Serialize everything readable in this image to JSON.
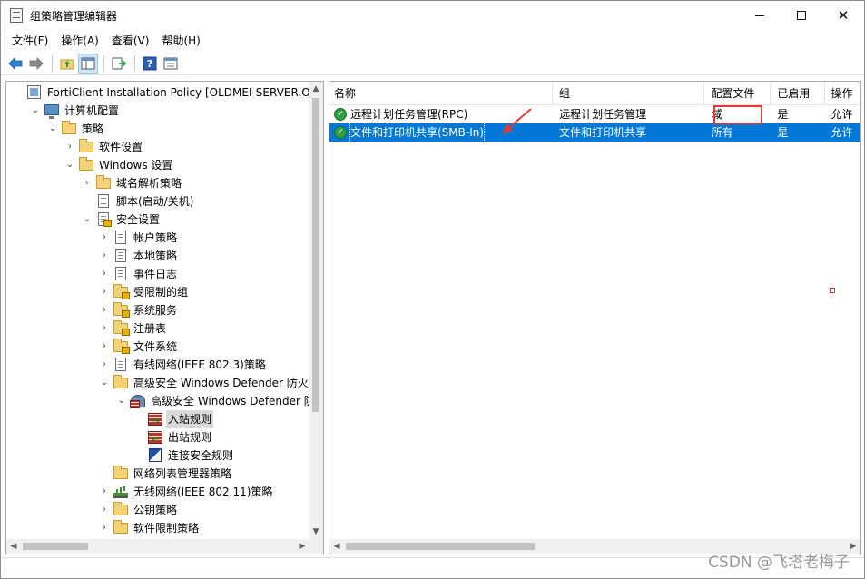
{
  "window": {
    "title": "组策略管理编辑器",
    "minimize": "—",
    "maximize": "☐",
    "close": "✕"
  },
  "menu": [
    "文件(F)",
    "操作(A)",
    "查看(V)",
    "帮助(H)"
  ],
  "toolbar": {
    "icons": [
      "back-arrow-icon",
      "forward-arrow-icon",
      "up-folder-icon",
      "show-hide-tree-icon",
      "export-list-icon",
      "help-icon",
      "properties-icon"
    ]
  },
  "tree": {
    "items": [
      {
        "label": "FortiClient Installation Policy [OLDMEI-SERVER.OLDM",
        "toggle": "",
        "icon": "policy"
      },
      {
        "label": "计算机配置",
        "toggle": "⌄",
        "icon": "computer"
      },
      {
        "label": "策略",
        "toggle": "⌄",
        "icon": "folder"
      },
      {
        "label": "软件设置",
        "toggle": "›",
        "icon": "folder"
      },
      {
        "label": "Windows 设置",
        "toggle": "⌄",
        "icon": "folder"
      },
      {
        "label": "域名解析策略",
        "toggle": "›",
        "icon": "folder"
      },
      {
        "label": "脚本(启动/关机)",
        "toggle": "",
        "icon": "doc"
      },
      {
        "label": "安全设置",
        "toggle": "⌄",
        "icon": "doc-lock"
      },
      {
        "label": "帐户策略",
        "toggle": "›",
        "icon": "doc"
      },
      {
        "label": "本地策略",
        "toggle": "›",
        "icon": "doc"
      },
      {
        "label": "事件日志",
        "toggle": "›",
        "icon": "doc"
      },
      {
        "label": "受限制的组",
        "toggle": "›",
        "icon": "folder-lock"
      },
      {
        "label": "系统服务",
        "toggle": "›",
        "icon": "folder-lock"
      },
      {
        "label": "注册表",
        "toggle": "›",
        "icon": "folder-lock"
      },
      {
        "label": "文件系统",
        "toggle": "›",
        "icon": "folder-lock"
      },
      {
        "label": "有线网络(IEEE 802.3)策略",
        "toggle": "›",
        "icon": "doc"
      },
      {
        "label": "高级安全 Windows Defender 防火墙",
        "toggle": "⌄",
        "icon": "folder"
      },
      {
        "label": "高级安全 Windows Defender 防火墙",
        "toggle": "⌄",
        "icon": "fw-root"
      },
      {
        "label": "入站规则",
        "toggle": "",
        "icon": "fw-in"
      },
      {
        "label": "出站规则",
        "toggle": "",
        "icon": "fw-out"
      },
      {
        "label": "连接安全规则",
        "toggle": "",
        "icon": "shield"
      },
      {
        "label": "网络列表管理器策略",
        "toggle": "",
        "icon": "folder"
      },
      {
        "label": "无线网络(IEEE 802.11)策略",
        "toggle": "›",
        "icon": "wifi"
      },
      {
        "label": "公钥策略",
        "toggle": "›",
        "icon": "folder"
      },
      {
        "label": "软件限制策略",
        "toggle": "›",
        "icon": "folder"
      }
    ]
  },
  "list": {
    "columns": [
      "名称",
      "组",
      "配置文件",
      "已启用",
      "操作"
    ],
    "rows": [
      {
        "name": "远程计划任务管理(RPC)",
        "group": "远程计划任务管理",
        "profile": "域",
        "enabled": "是",
        "action": "允许"
      },
      {
        "name": "文件和打印机共享(SMB-In)",
        "group": "文件和打印机共享",
        "profile": "所有",
        "enabled": "是",
        "action": "允许"
      }
    ]
  },
  "watermark": "CSDN @飞塔老梅子",
  "colors": {
    "selection": "#0078d7",
    "annotation": "#e53935",
    "enabled_check": "#2f9e44"
  }
}
